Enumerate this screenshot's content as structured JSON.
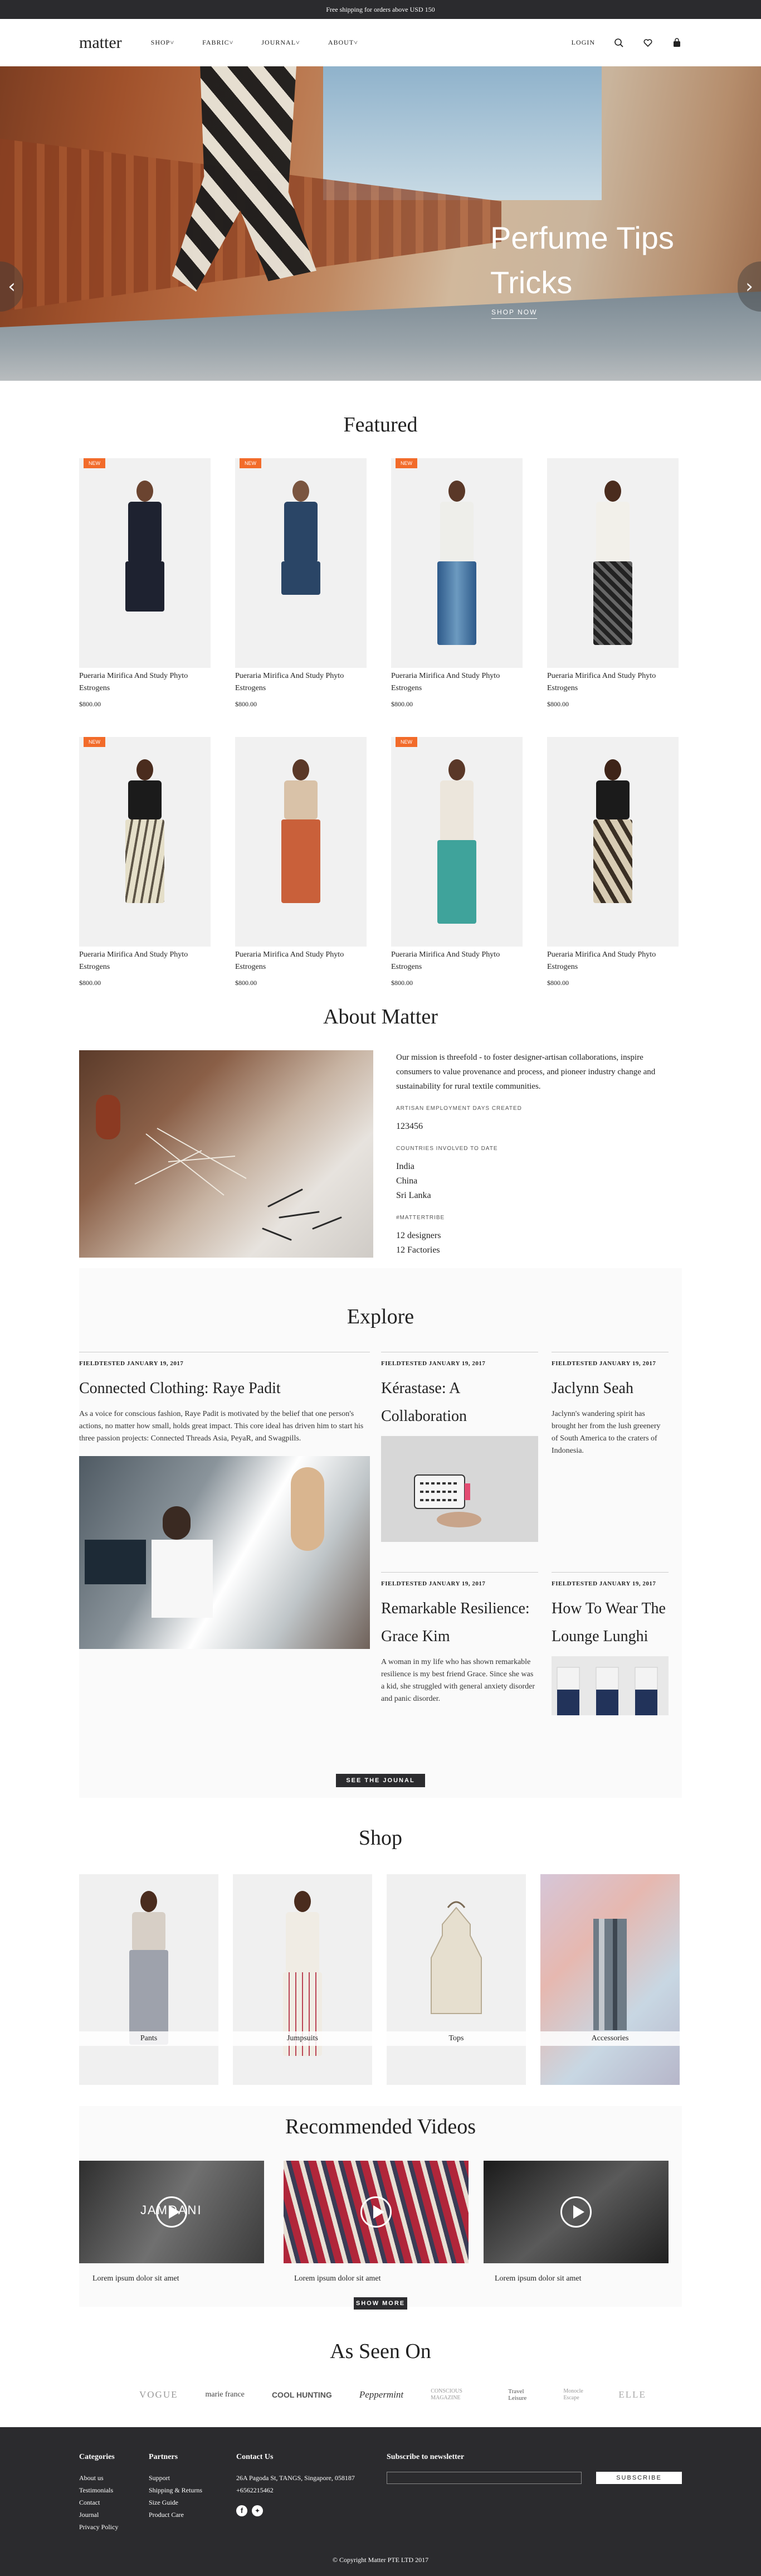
{
  "promo": {
    "text": "Free shipping for orders above USD 150"
  },
  "header": {
    "logo": "matter",
    "nav": [
      "SHOP",
      "FABRIC",
      "JOURNAL",
      "ABOUT"
    ],
    "login": "LOGIN",
    "icons": [
      "search-icon",
      "heart-icon",
      "bag-icon"
    ]
  },
  "hero": {
    "title_line1": "Perfume Tips",
    "title_line2": "Tricks",
    "link": "SHOP NOW",
    "prev": "‹",
    "next": "›"
  },
  "featured": {
    "title": "Featured",
    "products": [
      {
        "name": "Pueraria Mirifica And Study Phyto Estrogens",
        "price": "$800.00",
        "badge": "NEW"
      },
      {
        "name": "Pueraria Mirifica And Study Phyto Estrogens",
        "price": "$800.00",
        "badge": "NEW"
      },
      {
        "name": "Pueraria Mirifica And Study Phyto Estrogens",
        "price": "$800.00",
        "badge": "NEW"
      },
      {
        "name": "Pueraria Mirifica And Study Phyto Estrogens",
        "price": "$800.00",
        "badge": ""
      },
      {
        "name": "Pueraria Mirifica And Study Phyto Estrogens",
        "price": "$800.00",
        "badge": "NEW"
      },
      {
        "name": "Pueraria Mirifica And Study Phyto Estrogens",
        "price": "$800.00",
        "badge": ""
      },
      {
        "name": "Pueraria Mirifica And Study Phyto Estrogens",
        "price": "$800.00",
        "badge": "NEW"
      },
      {
        "name": "Pueraria Mirifica And Study Phyto Estrogens",
        "price": "$800.00",
        "badge": ""
      }
    ]
  },
  "about": {
    "title": "About Matter",
    "mission": "Our mission is threefold - to foster designer-artisan collaborations, inspire consumers to value provenance and process, and pioneer industry change and sustainability for rural textile communities.",
    "label1": "ARTISAN EMPLOYMENT DAYS CREATED",
    "value1": "123456",
    "label2": "COUNTRIES INVOLVED TO DATE",
    "countries": [
      "India",
      "China",
      "Sri Lanka"
    ],
    "label3": "#MATTERTRIBE",
    "tribe": [
      "12 designers",
      "12 Factories"
    ]
  },
  "explore": {
    "title": "Explore",
    "button": "SEE THE JOUNAL",
    "posts": [
      {
        "date": "FIELDTESTED JANUARY 19, 2017",
        "title": "Connected Clothing: Raye Padit",
        "body": "As a voice for conscious fashion, Raye Padit is motivated by the belief that one person's actions, no matter how small, holds great impact. This core ideal has driven him to start his three passion projects: Connected Threads Asia, PeyaR, and Swagpills."
      },
      {
        "date": "FIELDTESTED JANUARY 19, 2017",
        "title": "Kérastase: A Collaboration",
        "body": ""
      },
      {
        "date": "FIELDTESTED JANUARY 19, 2017",
        "title": "Jaclynn Seah",
        "body": "Jaclynn's wandering spirit has brought her from the lush greenery of South America to the craters of Indonesia."
      },
      {
        "date": "FIELDTESTED JANUARY 19, 2017",
        "title": "Remarkable Resilience: Grace Kim",
        "body": "A woman in my life who has shown remarkable resilience is my best friend Grace. Since she was a kid, she struggled with general anxiety disorder and panic disorder."
      },
      {
        "date": "FIELDTESTED JANUARY 19, 2017",
        "title": "How To Wear The Lounge Lunghi",
        "body": ""
      }
    ]
  },
  "shop": {
    "title": "Shop",
    "categories": [
      "Pants",
      "Jumpsuits",
      "Tops",
      "Accessories"
    ]
  },
  "videos": {
    "title": "Recommended Videos",
    "button": "SHOW MORE",
    "items": [
      {
        "caption": "Lorem ipsum dolor sit amet",
        "overlay": "JAMDANI"
      },
      {
        "caption": "Lorem ipsum dolor sit amet",
        "overlay": ""
      },
      {
        "caption": "Lorem ipsum dolor sit amet",
        "overlay": ""
      }
    ]
  },
  "seen": {
    "title": "As Seen On",
    "brands": [
      "VOGUE",
      "marie france",
      "COOL HUNTING",
      "Peppermint",
      "CONSCIOUS MAGAZINE",
      "Travel Leisure",
      "Monocle Escape",
      "ELLE"
    ]
  },
  "footer": {
    "categories": {
      "title": "Categories",
      "links": [
        "About us",
        "Testimonials",
        "Contact",
        "Journal",
        "Privacy Policy"
      ]
    },
    "partners": {
      "title": "Partners",
      "links": [
        "Support",
        "Shipping & Returns",
        "Size Guide",
        "Product Care"
      ]
    },
    "contact": {
      "title": "Contact Us",
      "address": "26A Pagoda St, TANGS, Singapore, 058187",
      "phone": "+6562215462"
    },
    "newsletter": {
      "title": "Subscribe to newsletter",
      "placeholder": "",
      "button": "SUBSCRIBE"
    },
    "copyright": "© Copyright Matter PTE LTD 2017"
  }
}
